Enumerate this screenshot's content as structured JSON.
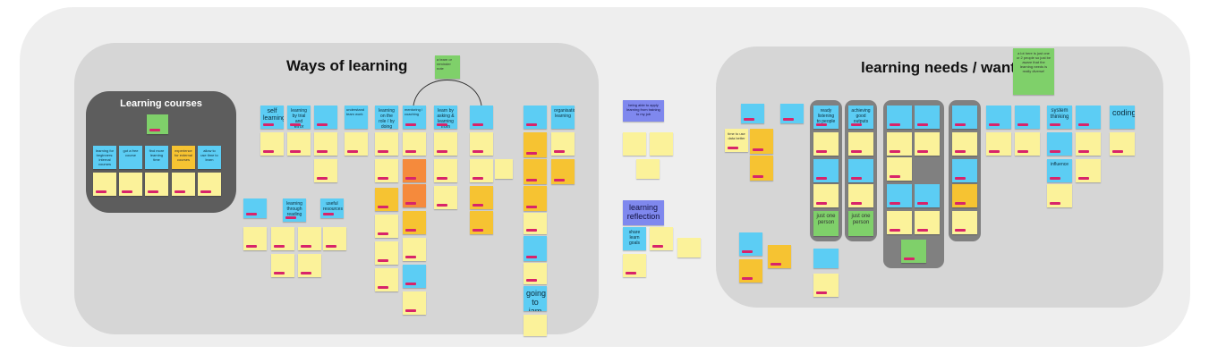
{
  "board": {
    "ways_title": "Ways of learning",
    "needs_title": "learning needs / wants",
    "courses_title": "Learning courses"
  },
  "labels": {
    "self_learning": "self learning",
    "learning_by_trial": "learning by trial and error",
    "understand_team": "understand team work",
    "learning_role": "learning on the role / by doing",
    "mentoring": "mentoring / coaching",
    "learning_from_others": "learn by asking & learning from others",
    "org_learning": "organisation learning",
    "being_able": "being able to apply learning from training to my job",
    "going_to_jam": "going to jam",
    "learning_reflection": "learning reflection",
    "share_learn_goals": "share learn goals",
    "ready_to_people": "ready listening to people",
    "achieving_outputs": "achieving good outputs",
    "just_one_person_1": "just one person",
    "just_one_person_2": "just one person",
    "system_thinking": "system thinking",
    "coding": "coding",
    "a_lot_here": "a lot here is just one or 2 people so just be aware that the learning needs is really diverse!",
    "useful_resources": "useful resources",
    "learning_through_reading": "learning through reading",
    "time_to_use": "time to use data better",
    "influence": "influence",
    "courses_1": "learning for beginners: internal courses",
    "courses_2": "got a free course",
    "courses_3": "find more learning time",
    "courses_4": "experience for external courses",
    "courses_5": "allow to use time to learn",
    "green_note": "a team or reminder note"
  },
  "colors": {
    "blue": "#5ccdf4",
    "yellow": "#fbf29a",
    "orange": "#f6c332",
    "red": "#f58a3c",
    "green": "#7fd06a",
    "purple": "#7f88ee",
    "tag": "#d8246a"
  }
}
